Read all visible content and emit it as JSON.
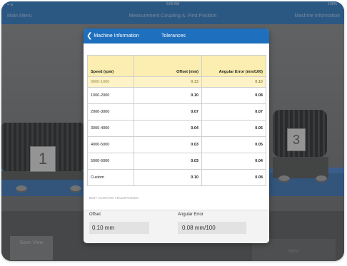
{
  "status": {
    "left": "•• ฅ",
    "time": "9:59 AM",
    "right": "100%"
  },
  "nav": {
    "left": "Main Menu",
    "title": "Measurement Coupling A: First Position",
    "right": "Machine Information"
  },
  "scene": {
    "label_1": "1",
    "label_3": "3"
  },
  "buttons": {
    "save_view": "Save View",
    "next": "Next"
  },
  "modal": {
    "back_label": "Machine Information",
    "title": "Tolerances",
    "table": {
      "headers": {
        "speed": "Speed (rpm)",
        "offset": "Offset (mm)",
        "angular": "Angular Error (mm/100)"
      },
      "rows": [
        {
          "speed": "0000-1000",
          "offset": "0.13",
          "angular": "0.10"
        },
        {
          "speed": "1000-2000",
          "offset": "0.10",
          "angular": "0.08"
        },
        {
          "speed": "2000-3000",
          "offset": "0.07",
          "angular": "0.07"
        },
        {
          "speed": "3000-4000",
          "offset": "0.04",
          "angular": "0.06"
        },
        {
          "speed": "4000-5000",
          "offset": "0.03",
          "angular": "0.05"
        },
        {
          "speed": "5000-6000",
          "offset": "0.03",
          "angular": "0.04"
        },
        {
          "speed": "Custom",
          "offset": "0.10",
          "angular": "0.08"
        }
      ]
    },
    "edit": {
      "section_title": "EDIT CUSTOM TOLERANCES",
      "offset_label": "Offset",
      "offset_value": "0.10 mm",
      "angular_label": "Angular Error",
      "angular_value": "0.08 mm/100"
    }
  },
  "colors": {
    "brand_blue": "#1e6fbe",
    "highlight_row": "#fdf3c6",
    "header_row": "#fbeeb0"
  },
  "icons": {
    "back": "chevron-left-icon"
  }
}
